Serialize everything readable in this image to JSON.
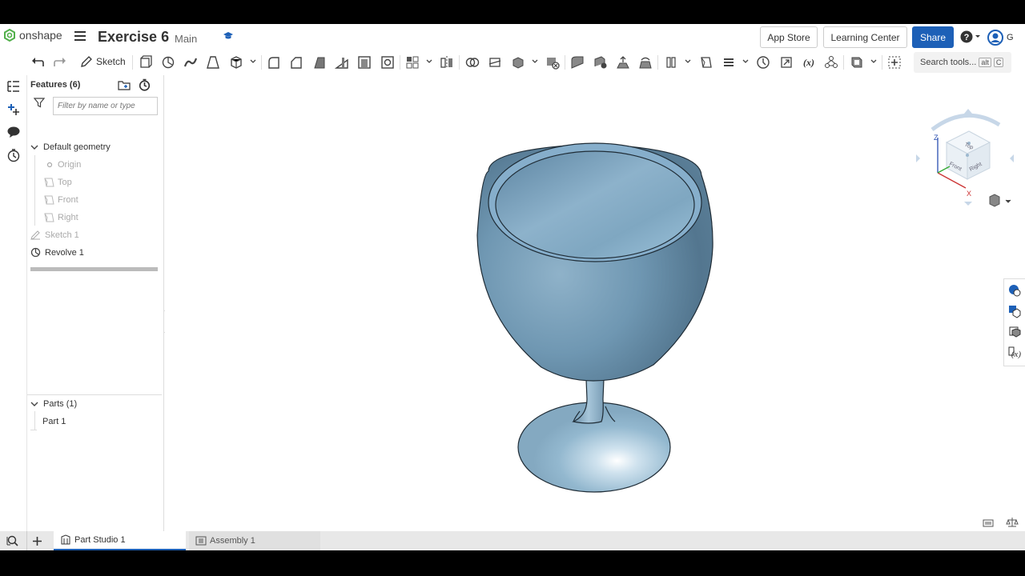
{
  "header": {
    "brand": "onshape",
    "doc_title": "Exercise 6",
    "branch": "Main",
    "app_store": "App Store",
    "learning_center": "Learning Center",
    "share": "Share",
    "user_initial": "G"
  },
  "toolbar": {
    "sketch_label": "Sketch",
    "search_label": "Search tools...",
    "shortcut_alt": "alt",
    "shortcut_key": "C"
  },
  "features": {
    "title": "Features (6)",
    "filter_placeholder": "Filter by name or type",
    "default_geometry": "Default geometry",
    "origin": "Origin",
    "planes": [
      "Top",
      "Front",
      "Right"
    ],
    "items": [
      "Sketch 1",
      "Revolve 1"
    ]
  },
  "parts": {
    "title": "Parts (1)",
    "items": [
      "Part 1"
    ]
  },
  "view_cube": {
    "top": "Top",
    "front": "Front",
    "right": "Right",
    "axis_z": "Z",
    "axis_x": "X"
  },
  "tabs": [
    "Part Studio 1",
    "Assembly 1"
  ],
  "colors": {
    "accent": "#1d60b7",
    "model": "#8fb6cf",
    "brand_green": "#52b04b"
  }
}
